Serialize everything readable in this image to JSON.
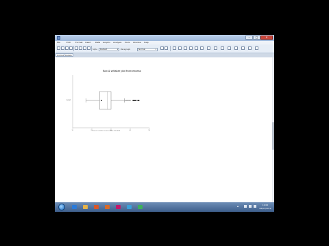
{
  "menu": [
    "File",
    "Edit",
    "Format",
    "Insert",
    "Data",
    "Graphs",
    "Analysis",
    "Tools",
    "Window",
    "Help"
  ],
  "toolbar": {
    "style_label": "Style",
    "style_value": "Default",
    "paragraph_label": "Paragraph",
    "paragraph_value": "Normal"
  },
  "side_tabs": [
    "Outline",
    "Details"
  ],
  "chart_data": {
    "type": "box",
    "title": "Box & whisker plot from excess",
    "xlabel": "Excess number of cases above threshold",
    "y_category": "Level",
    "xticks": [
      10,
      20,
      30,
      40,
      50
    ],
    "xlim": [
      10,
      50
    ],
    "box": {
      "min": 17,
      "q1": 24,
      "median": 28,
      "q3": 27.5,
      "max": 37
    },
    "mean": 25,
    "outliers": [
      37.5,
      38,
      38.5,
      39,
      39.5,
      40,
      41.5,
      42,
      42.5,
      43,
      44,
      44.5
    ]
  },
  "taskbar": {
    "apps": [
      {
        "name": "ie-app",
        "color": "#2a7ad9"
      },
      {
        "name": "explorer-app",
        "color": "#e6b34a"
      },
      {
        "name": "media-player-app",
        "color": "#d9572a"
      },
      {
        "name": "firefox-app",
        "color": "#d96b2a"
      },
      {
        "name": "minitab-app",
        "color": "#c2186b"
      },
      {
        "name": "photos-app",
        "color": "#3aa0d9"
      },
      {
        "name": "spreadsheet-app",
        "color": "#3cb05a"
      }
    ],
    "clock_time": "12:00",
    "clock_date": "08/03/2012"
  }
}
